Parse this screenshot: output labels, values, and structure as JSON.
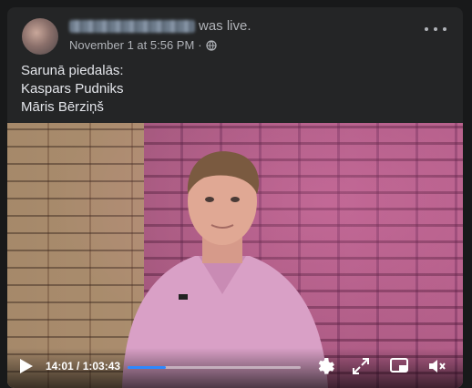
{
  "post": {
    "status_text": "was live.",
    "timestamp": "November 1 at 5:56 PM",
    "separator": "·",
    "body_lines": [
      "Sarunā piedalās:",
      "Kaspars Pudniks",
      "Māris Bērziņš"
    ]
  },
  "video": {
    "time_display": "14:01 / 1:03:43",
    "progress_fraction": 0.22,
    "icons": [
      "play-icon",
      "gear-icon",
      "fullscreen-icon",
      "picture-in-picture-icon",
      "volume-muted-icon"
    ]
  },
  "colors": {
    "progress_fill": "#2d88ff",
    "card": "#242526",
    "text": "#e4e6eb",
    "meta": "#b0b3b8"
  }
}
